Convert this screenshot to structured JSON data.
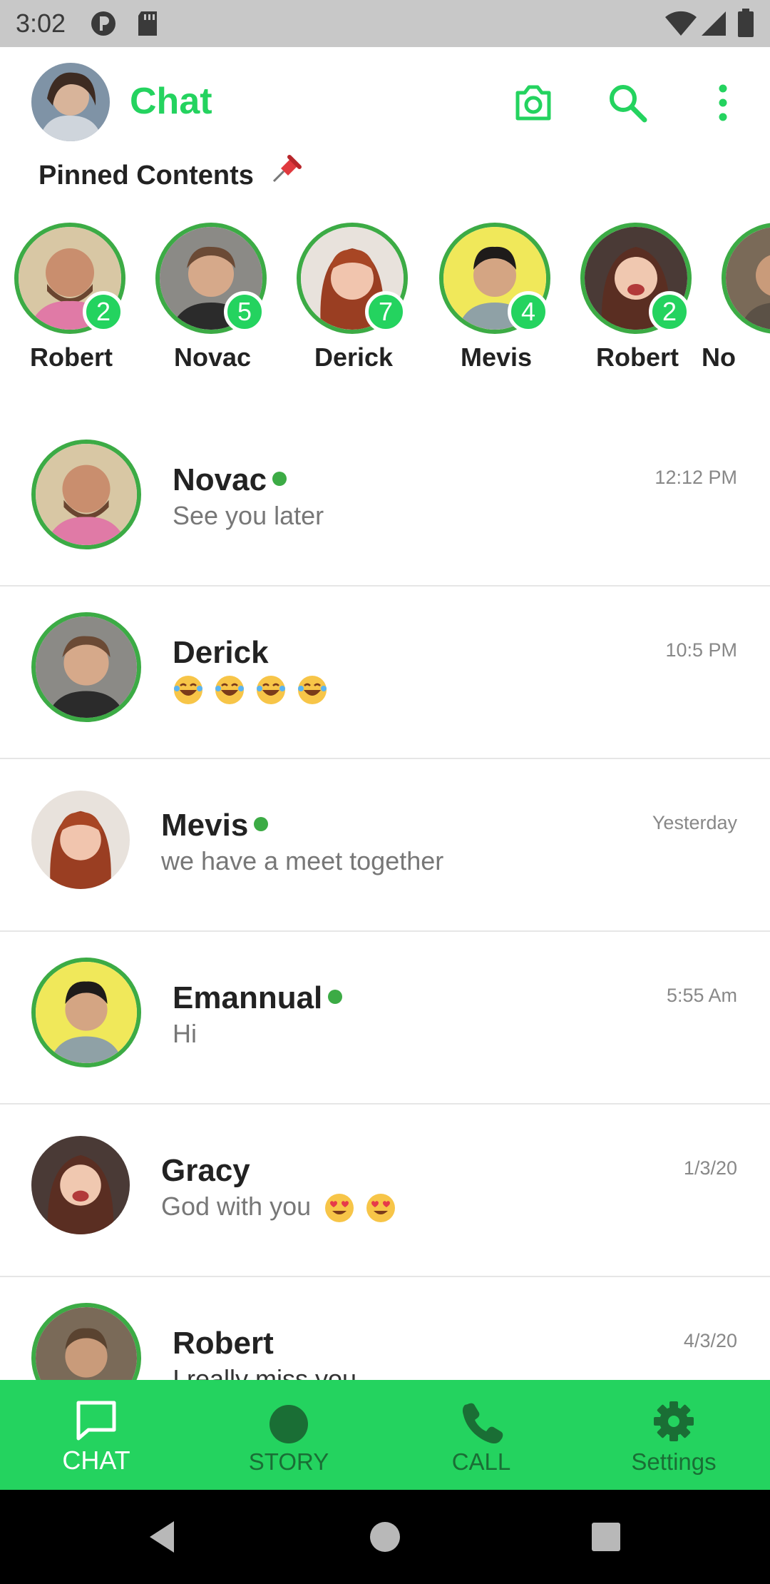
{
  "status_bar": {
    "time": "3:02"
  },
  "header": {
    "title": "Chat"
  },
  "pinned": {
    "title": "Pinned Contents",
    "items": [
      {
        "name": "Robert",
        "count": "2"
      },
      {
        "name": "Novac",
        "count": "5"
      },
      {
        "name": "Derick",
        "count": "7"
      },
      {
        "name": "Mevis",
        "count": "4"
      },
      {
        "name": "Robert",
        "count": "2"
      },
      {
        "name": "No",
        "count": ""
      }
    ]
  },
  "chats": [
    {
      "name": "Novac",
      "message": "See you later",
      "time": "12:12 PM",
      "online": true
    },
    {
      "name": "Derick",
      "message": "",
      "time": "10:5 PM",
      "online": false
    },
    {
      "name": "Mevis",
      "message": "we have a meet together",
      "time": "Yesterday",
      "online": true
    },
    {
      "name": "Emannual",
      "message": "Hi",
      "time": "5:55 Am",
      "online": true
    },
    {
      "name": "Gracy",
      "message": "God with you",
      "time": "1/3/20",
      "online": false
    },
    {
      "name": "Robert",
      "message": "I really miss you",
      "time": "4/3/20",
      "online": false
    }
  ],
  "bottom_nav": [
    {
      "label": "CHAT",
      "icon": "chat-bubble-icon",
      "active": true
    },
    {
      "label": "STORY",
      "icon": "story-circle-icon",
      "active": false
    },
    {
      "label": "CALL",
      "icon": "phone-icon",
      "active": false
    },
    {
      "label": "Settings",
      "icon": "gear-icon",
      "active": false
    }
  ],
  "colors": {
    "accent": "#24d35f",
    "ring": "#3cab45",
    "nav_inactive": "#1a6e35"
  }
}
